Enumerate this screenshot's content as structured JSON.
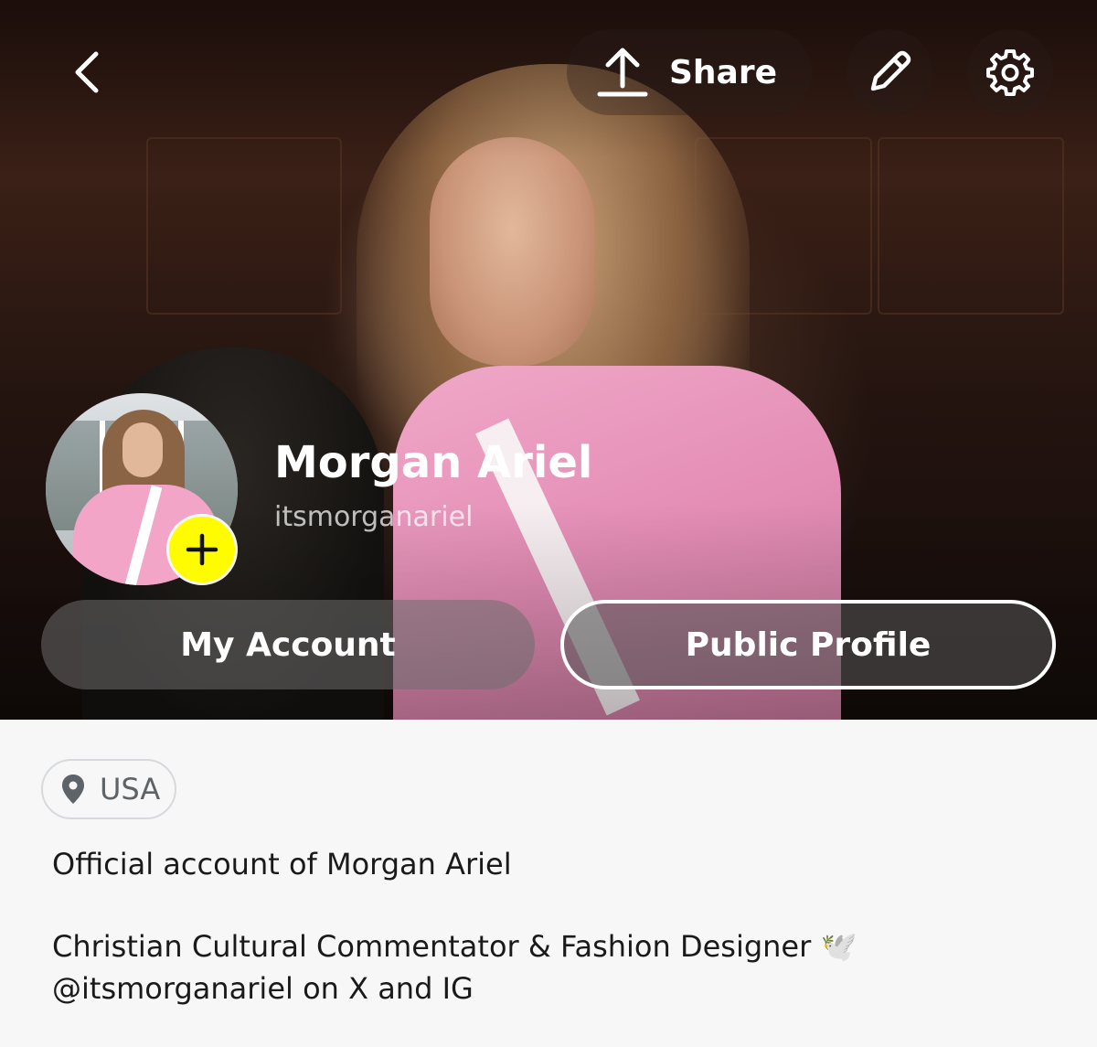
{
  "header": {
    "share_label": "Share",
    "icons": {
      "back": "chevron-left-icon",
      "share": "upload-icon",
      "edit": "pencil-icon",
      "settings": "gear-icon"
    }
  },
  "profile": {
    "display_name": "Morgan Ariel",
    "username": "itsmorganariel",
    "add_badge_color": "#fffc00"
  },
  "tabs": {
    "my_account": "My Account",
    "public_profile": "Public Profile",
    "selected": "public_profile"
  },
  "location": {
    "label": "USA",
    "icon": "map-pin-icon"
  },
  "bio": {
    "line1": "Official account of Morgan Ariel",
    "line2": "Christian Cultural Commentator & Fashion Designer 🕊️",
    "line3": "@itsmorganariel on X and IG"
  }
}
